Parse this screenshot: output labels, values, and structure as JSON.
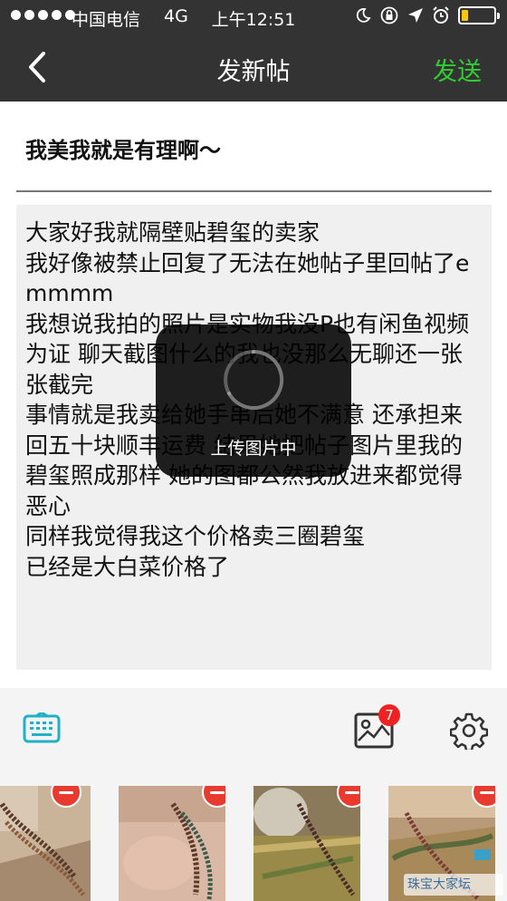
{
  "status_bar": {
    "carrier": "中国电信",
    "network": "4G",
    "time": "上午12:51",
    "battery_level": 0.2
  },
  "nav": {
    "back_icon": "chevron-left-icon",
    "title": "发新帖",
    "send_label": "发送"
  },
  "post": {
    "subject": "我美我就是有理啊～",
    "content": "大家好我就隔壁贴碧玺的卖家\n我好像被禁止回复了无法在她帖子里回帖了emmmm\n我想说我拍的照片是实物我没P也有闲鱼视频为证 聊天截图什么的我也没那么无聊还一张张截完\n事情就是我卖给她手串后她不满意 还承担来回五十块顺丰运费 结果她把帖子图片里我的碧玺照成那样 她的图都公然我放进来都觉得恶心\n同样我觉得我这个价格卖三圈碧玺\n已经是大白菜价格了"
  },
  "loading": {
    "text": "上传图片中"
  },
  "toolbar": {
    "keyboard_icon": "keyboard-icon",
    "image_icon": "image-icon",
    "image_badge": "7",
    "settings_icon": "gear-icon"
  },
  "thumbnails": [
    {
      "name": "photo-1"
    },
    {
      "name": "photo-2"
    },
    {
      "name": "photo-3"
    },
    {
      "name": "photo-4"
    }
  ],
  "watermark": "珠宝大家坛",
  "colors": {
    "header_bg": "#333333",
    "send_green": "#33cc33",
    "accent_teal": "#20b0c8",
    "badge_red": "#ee2222",
    "remove_red": "#e83a2f"
  }
}
